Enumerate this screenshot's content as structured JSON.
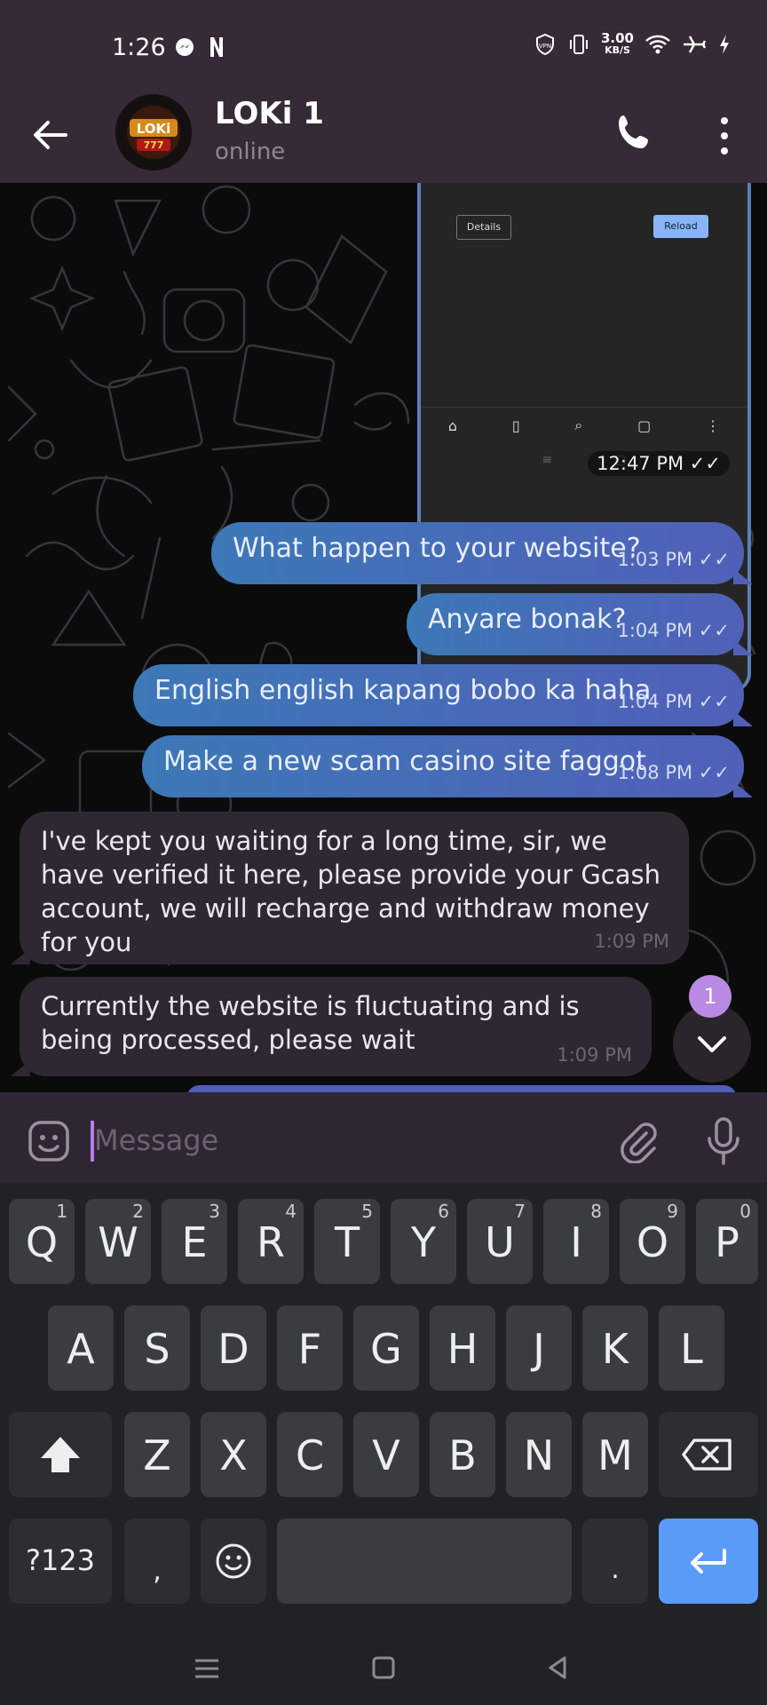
{
  "status_bar": {
    "time": "1:26",
    "speed_value": "3.00",
    "speed_unit": "KB/S",
    "vpn_label": "VPN"
  },
  "header": {
    "contact_name": "LOKi 1",
    "contact_status": "online",
    "avatar_text": "LOKi"
  },
  "image_message": {
    "details_label": "Details",
    "reload_label": "Reload",
    "time": "12:47 PM"
  },
  "messages": [
    {
      "direction": "out",
      "text": "What happen to your website?",
      "time": "1:03 PM"
    },
    {
      "direction": "out",
      "text": "Anyare bonak?",
      "time": "1:04 PM"
    },
    {
      "direction": "out",
      "text": "English english kapang bobo ka haha",
      "time": "1:04 PM"
    },
    {
      "direction": "out",
      "text": "Make a new scam casino site faggot",
      "time": "1:08 PM"
    },
    {
      "direction": "in",
      "text": "I've kept you waiting for a long time, sir, we have verified it here, please provide your Gcash account, we will recharge and withdraw money for you",
      "time": "1:09 PM"
    },
    {
      "direction": "in",
      "text": "Currently the website is fluctuating and is being processed, please wait",
      "time": "1:09 PM"
    }
  ],
  "unread_count": "1",
  "input": {
    "placeholder": "Message",
    "value": ""
  },
  "keyboard": {
    "row1": [
      {
        "key": "Q",
        "hint": "1"
      },
      {
        "key": "W",
        "hint": "2"
      },
      {
        "key": "E",
        "hint": "3"
      },
      {
        "key": "R",
        "hint": "4"
      },
      {
        "key": "T",
        "hint": "5"
      },
      {
        "key": "Y",
        "hint": "6"
      },
      {
        "key": "U",
        "hint": "7"
      },
      {
        "key": "I",
        "hint": "8"
      },
      {
        "key": "O",
        "hint": "9"
      },
      {
        "key": "P",
        "hint": "0"
      }
    ],
    "row2": [
      "A",
      "S",
      "D",
      "F",
      "G",
      "H",
      "J",
      "K",
      "L"
    ],
    "row3": [
      "Z",
      "X",
      "C",
      "V",
      "B",
      "N",
      "M"
    ],
    "symbols_label": "?123",
    "comma_label": ",",
    "period_label": "."
  },
  "colors": {
    "header_bg": "#352a35",
    "outgoing_bubble_start": "#3d78b7",
    "outgoing_bubble_end": "#5060b8",
    "incoming_bubble": "#2f2833",
    "accent": "#b87bf2",
    "enter_key": "#5a9bf7"
  }
}
